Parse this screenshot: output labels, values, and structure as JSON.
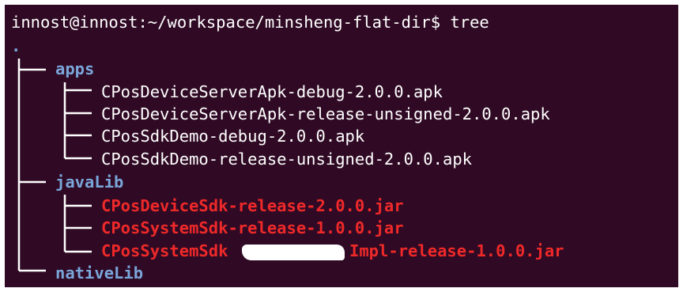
{
  "terminal": {
    "prompt_line": "innost@innost:~/workspace/minsheng-flat-dir$ tree",
    "root_dot": "."
  },
  "tree": {
    "apps": {
      "label": "apps",
      "files": [
        "CPosDeviceServerApk-debug-2.0.0.apk",
        "CPosDeviceServerApk-release-unsigned-2.0.0.apk",
        "CPosSdkDemo-debug-2.0.0.apk",
        "CPosSdkDemo-release-unsigned-2.0.0.apk"
      ]
    },
    "javaLib": {
      "label": "javaLib",
      "files": [
        "CPosDeviceSdk-release-2.0.0.jar",
        "CPosSystemSdk-release-1.0.0.jar"
      ],
      "partial_file": {
        "prefix": "CPosSystemSdk",
        "suffix": "Impl-release-1.0.0.jar"
      }
    },
    "nativeLib": {
      "label": "nativeLib"
    }
  },
  "colors": {
    "background": "#300a24",
    "directory": "#7aa6da",
    "executable": "#ef2929",
    "text": "#ffffff"
  }
}
